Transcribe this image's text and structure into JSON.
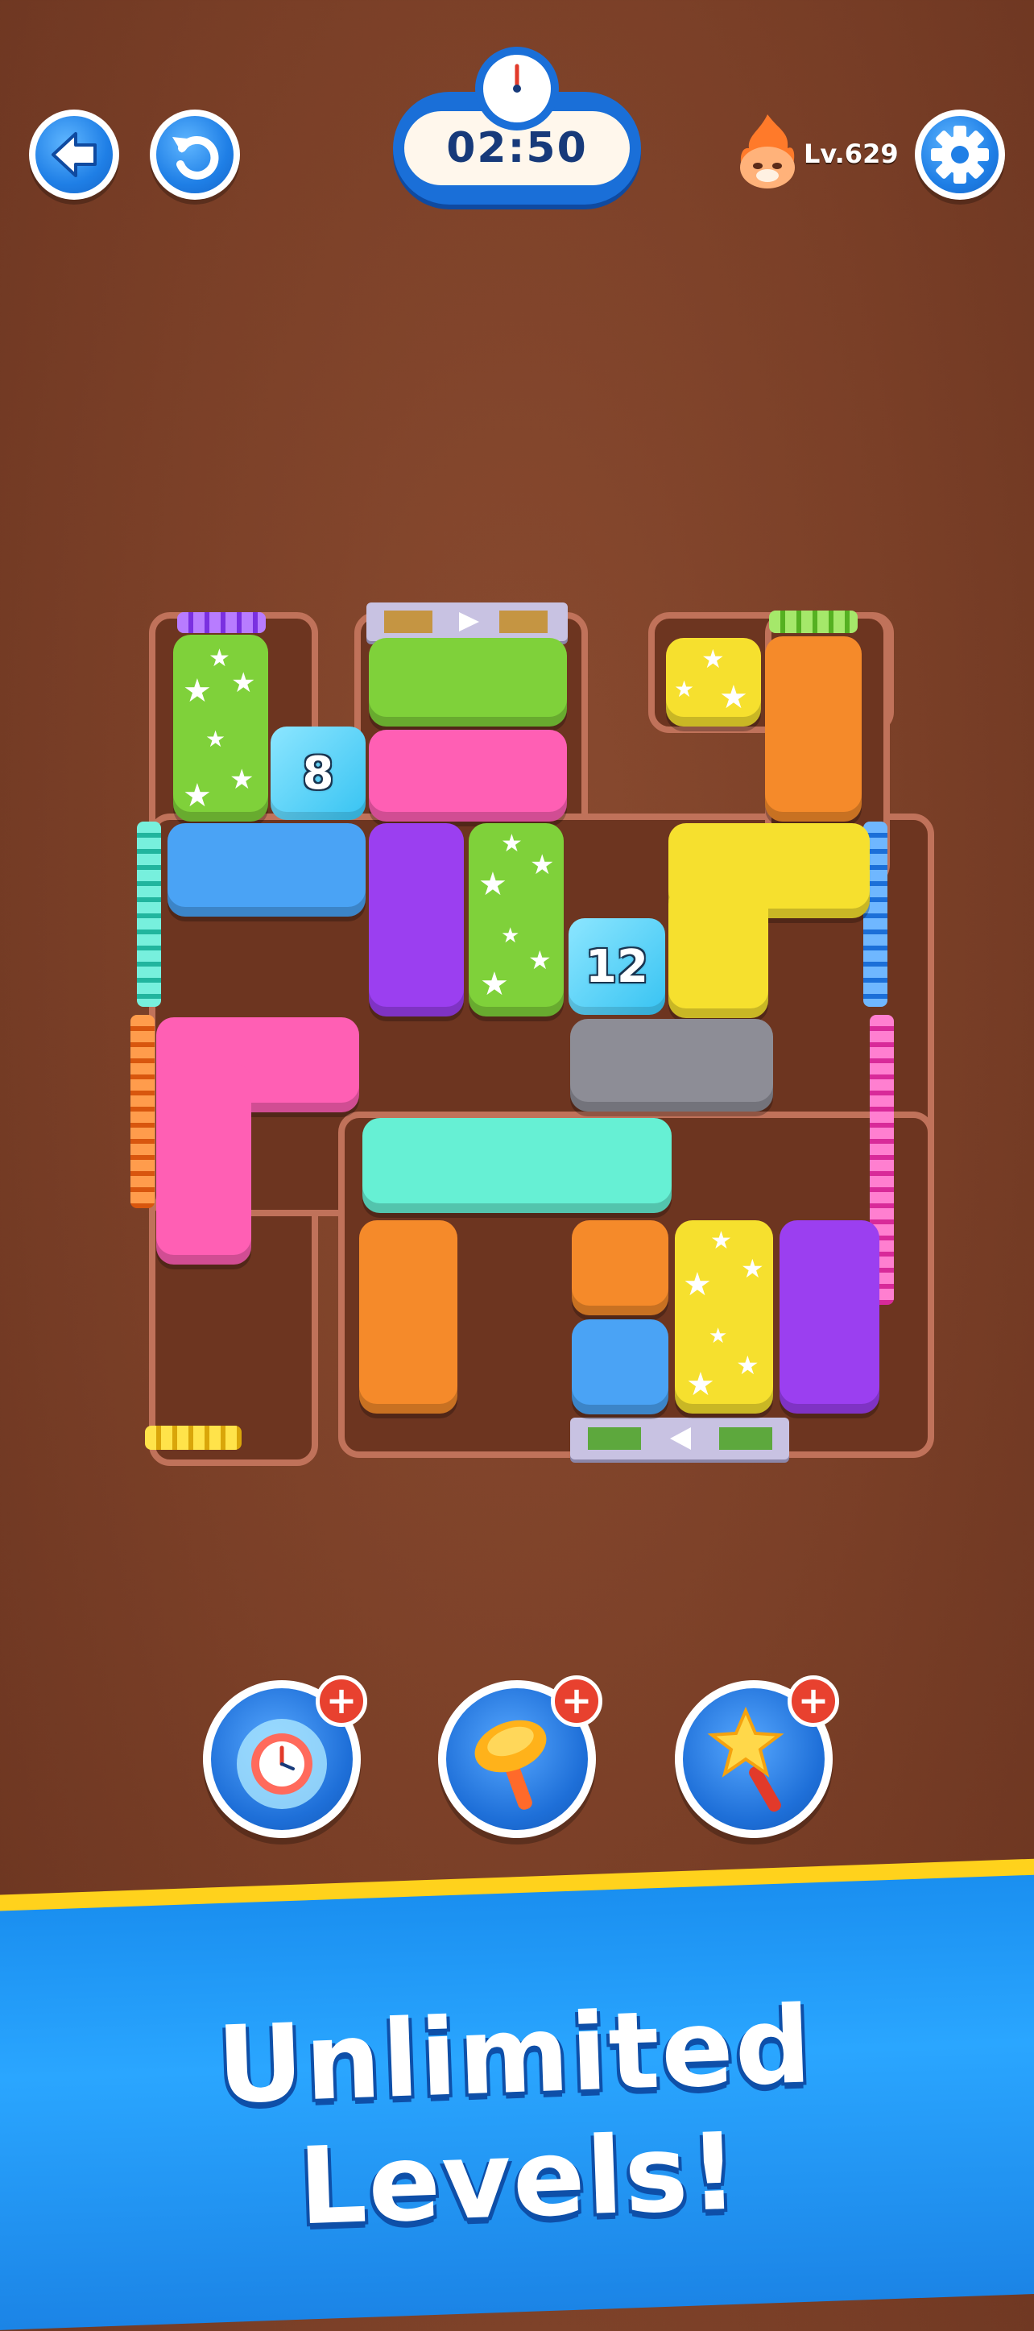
{
  "header": {
    "back_icon": "arrow-left-icon",
    "restart_icon": "restart-icon",
    "timer": "02:50",
    "timer_icon": "stopwatch-icon",
    "level": "Lv.629",
    "streak_icon": "fire-cat-icon",
    "settings_icon": "gear-icon"
  },
  "board": {
    "ice_blocks": [
      {
        "count": "8"
      },
      {
        "count": "12"
      }
    ],
    "colors": {
      "green": "#7fd13a",
      "pink": "#ff5fb4",
      "blue": "#4aa3f5",
      "purple": "#9b3ff0",
      "orange": "#f58a2a",
      "yellow": "#f6e02e",
      "teal": "#66f0d4",
      "gray": "#8d8d96"
    }
  },
  "boosters": [
    {
      "icon": "freeze-clock-icon"
    },
    {
      "icon": "hammer-icon"
    },
    {
      "icon": "magic-wand-icon"
    }
  ],
  "banner": {
    "text": "Unlimited Levels!"
  }
}
